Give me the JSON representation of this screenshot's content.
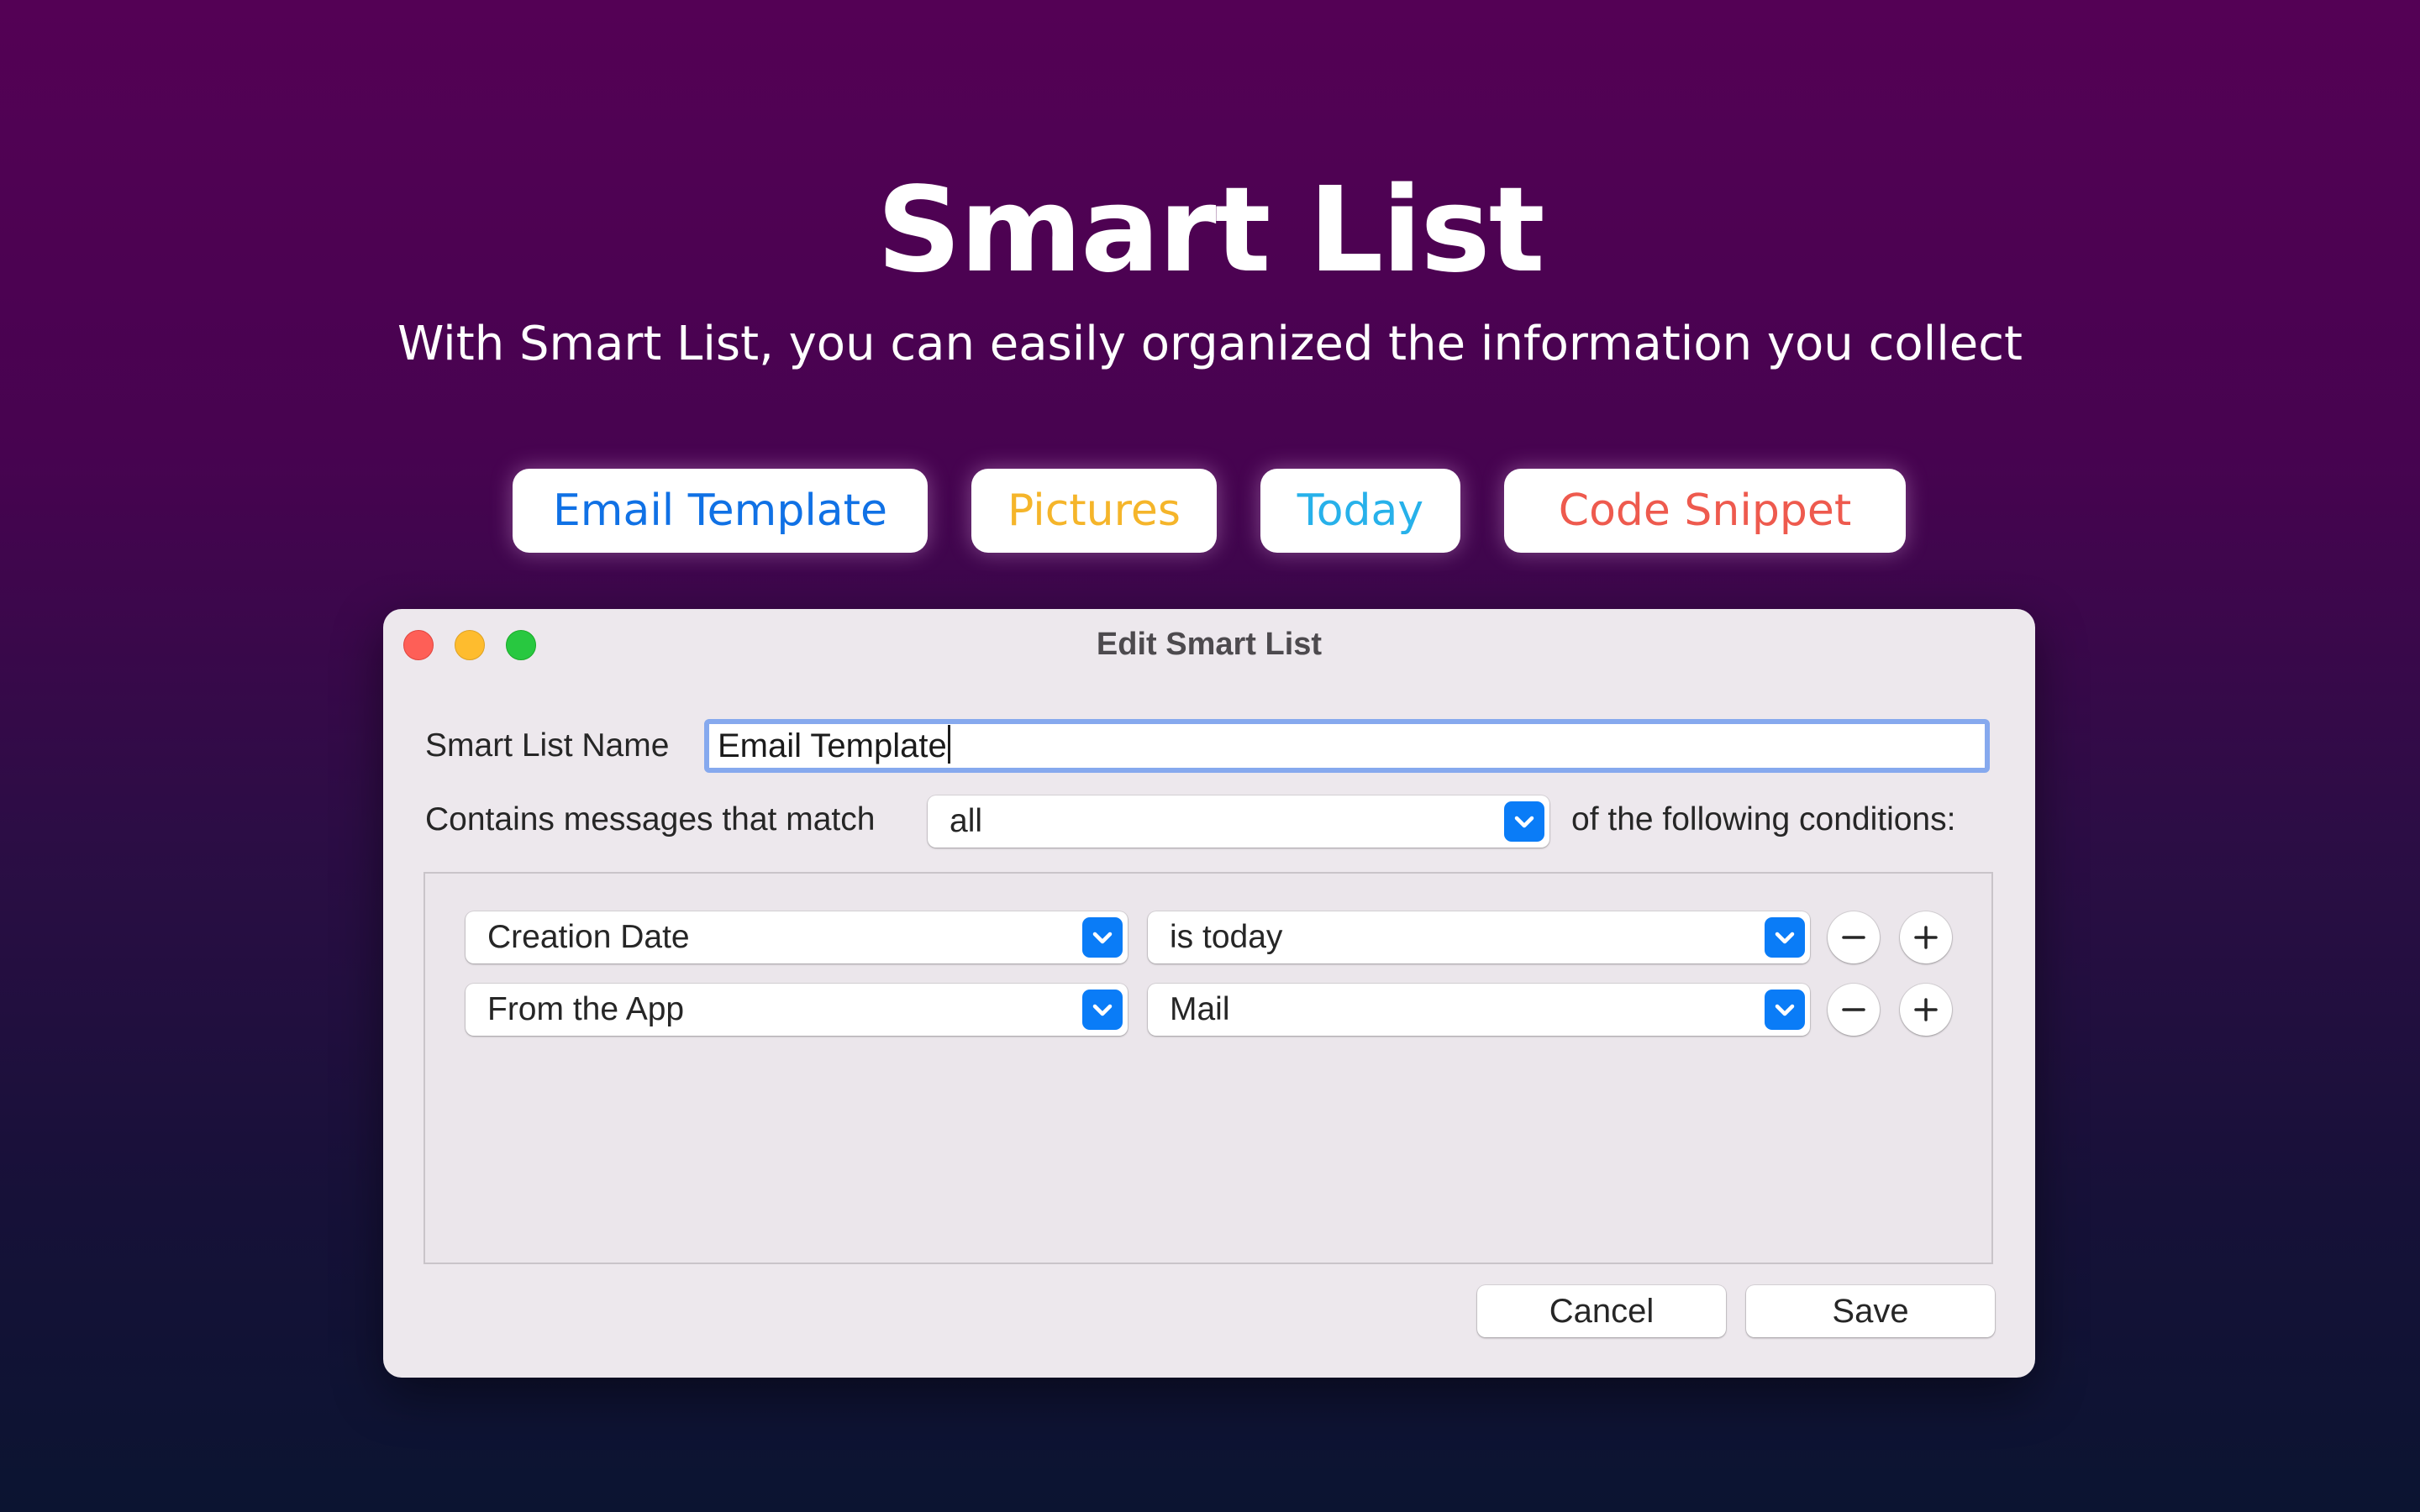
{
  "hero": {
    "title": "Smart List",
    "subtitle": "With Smart List, you can easily organized the information you collect"
  },
  "chips": [
    {
      "label": "Email Template",
      "color": "#1071e5"
    },
    {
      "label": "Pictures",
      "color": "#f5b52a"
    },
    {
      "label": "Today",
      "color": "#27b1ea"
    },
    {
      "label": "Code Snippet",
      "color": "#ee5a4e"
    }
  ],
  "window": {
    "title": "Edit Smart List",
    "traffic_lights": {
      "close": "#fe5f57",
      "minimize": "#febc2e",
      "zoom": "#28c840"
    },
    "name_label": "Smart List Name",
    "name_value": "Email Template",
    "match_label": "Contains messages that match",
    "match_value": "all",
    "match_suffix": "of the following conditions:",
    "conditions": [
      {
        "field": "Creation Date",
        "operator": "is today"
      },
      {
        "field": "From the App",
        "operator": "Mail"
      }
    ],
    "cancel_label": "Cancel",
    "save_label": "Save",
    "accent_color": "#0a7cf7",
    "focus_ring_color": "#86a9ee"
  }
}
